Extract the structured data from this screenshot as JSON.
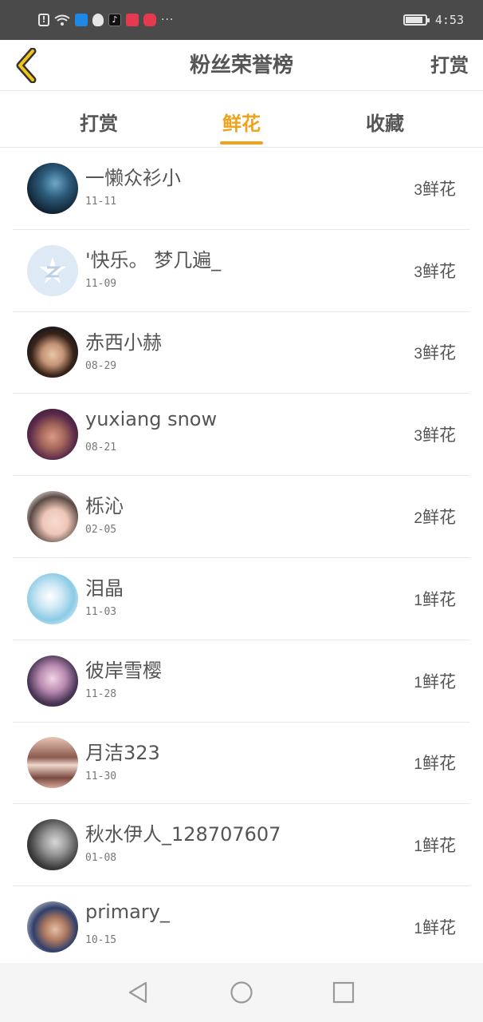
{
  "status_bar": {
    "time": "4:53",
    "left_icons": [
      "alert-icon",
      "wifi-icon",
      "shield-app-icon",
      "qq-icon",
      "tiktok-icon",
      "calendar-app-icon",
      "red-app-icon",
      "more-icon"
    ],
    "more_text": "···",
    "battery_level": 0.9
  },
  "header": {
    "title": "粉丝荣誉榜",
    "action_label": "打赏",
    "back_icon": "chevron-left-icon",
    "accent_color": "#f0a21b"
  },
  "tabs": [
    {
      "label": "打赏",
      "active": false
    },
    {
      "label": "鲜花",
      "active": true
    },
    {
      "label": "收藏",
      "active": false
    }
  ],
  "fans": [
    {
      "name": "一懒众衫小",
      "date": "11-11",
      "count": "3",
      "unit": "鲜花"
    },
    {
      "name": "'快乐。 梦几遍_",
      "date": "11-09",
      "count": "3",
      "unit": "鲜花"
    },
    {
      "name": "赤西小赫",
      "date": "08-29",
      "count": "3",
      "unit": "鲜花"
    },
    {
      "name": "yuxiang snow",
      "date": "08-21",
      "count": "3",
      "unit": "鲜花"
    },
    {
      "name": "栎沁",
      "date": "02-05",
      "count": "2",
      "unit": "鲜花"
    },
    {
      "name": "泪晶",
      "date": "11-03",
      "count": "1",
      "unit": "鲜花"
    },
    {
      "name": "彼岸雪樱",
      "date": "11-28",
      "count": "1",
      "unit": "鲜花"
    },
    {
      "name": "月洁323",
      "date": "11-30",
      "count": "1",
      "unit": "鲜花"
    },
    {
      "name": "秋水伊人_128707607",
      "date": "01-08",
      "count": "1",
      "unit": "鲜花"
    },
    {
      "name": "primary_",
      "date": "10-15",
      "count": "1",
      "unit": "鲜花"
    }
  ],
  "nav_bar": {
    "buttons": [
      "back-triangle-icon",
      "home-circle-icon",
      "recents-square-icon"
    ]
  }
}
